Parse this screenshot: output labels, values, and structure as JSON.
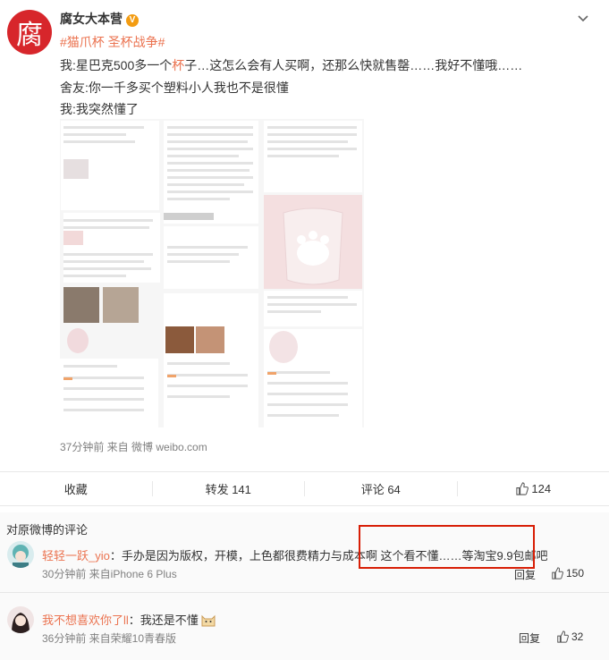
{
  "post": {
    "avatar_text": "腐",
    "username": "腐女大本营",
    "hashtags": "#猫爪杯 圣杯战争#",
    "line1_pre": "我:星巴克500多一个",
    "line1_hl": "杯",
    "line1_post": "子…这怎么会有人买啊，还那么快就售罄……我好不懂哦……",
    "line2": "舍友:你一千多买个塑料小人我也不是很懂",
    "line3": "我:我突然懂了",
    "meta": "37分钟前 来自 微博 weibo.com"
  },
  "actions": {
    "favorite": "收藏",
    "repost": "转发 141",
    "comment": "评论 64",
    "like": "124"
  },
  "comments": {
    "title": "对原微博的评论",
    "items": [
      {
        "name": "轻轻一跃_yio",
        "text": "：手办是因为版权，开模，上色都很费精力与成本啊  这个看不懂……等淘宝9.9包邮吧",
        "meta": "30分钟前 来自iPhone 6 Plus",
        "reply": "回复",
        "likes": "150"
      },
      {
        "name": "我不想喜欢你了ll",
        "text": "：我还是不懂",
        "meta": "36分钟前 来自荣耀10青春版",
        "reply": "回复",
        "likes": "32"
      }
    ]
  },
  "colors": {
    "accent": "#eb7350",
    "avatar_bg": "#d7262b",
    "highlight_box": "#d81e06"
  }
}
